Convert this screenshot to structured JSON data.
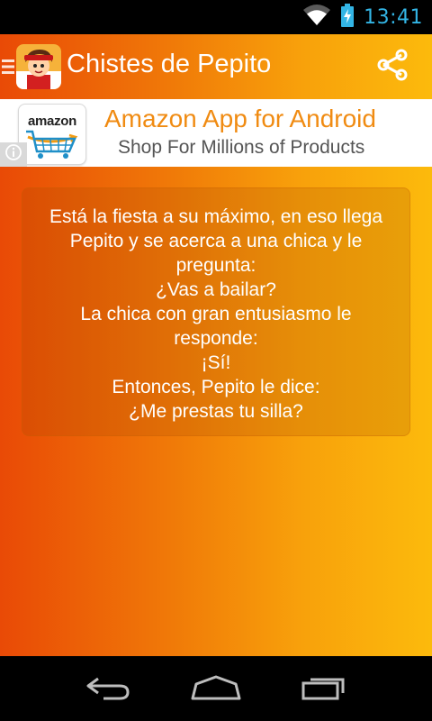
{
  "status_bar": {
    "time": "13:41",
    "icons": [
      "wifi-icon",
      "battery-charging-icon"
    ],
    "color": "#33b5e5"
  },
  "action_bar": {
    "title": "Chistes de Pepito",
    "icons": [
      "drawer-menu-icon",
      "app-logo",
      "share-icon"
    ]
  },
  "ad": {
    "logo_text": "amazon",
    "headline": "Amazon App for Android",
    "subline": "Shop For Millions of Products",
    "info_icon": "info-icon",
    "headline_color": "#f08b12"
  },
  "joke": {
    "lines": [
      "Está la fiesta a su máximo, en eso llega",
      "Pepito y se acerca a una chica y le",
      "pregunta:",
      "¿Vas a bailar?",
      "La chica con gran entusiasmo le",
      "responde:",
      "¡Sí!",
      "Entonces, Pepito le dice:",
      "¿Me prestas tu silla?"
    ]
  },
  "nav_bar": {
    "icons": [
      "back-icon",
      "home-icon",
      "recent-apps-icon"
    ]
  },
  "colors": {
    "gradient_start": "#e94a06",
    "gradient_end": "#fcba0c"
  }
}
